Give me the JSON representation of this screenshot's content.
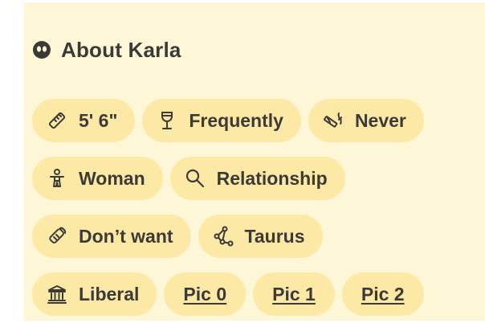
{
  "profile": {
    "heading": "About Karla",
    "heading_icon": "bumble-honeycomb-icon"
  },
  "tags": {
    "row1": [
      {
        "label": "5' 6\"",
        "icon": "ruler-icon"
      },
      {
        "label": "Frequently",
        "icon": "wine-glass-icon"
      },
      {
        "label": "Never",
        "icon": "smoking-icon"
      }
    ],
    "row2": [
      {
        "label": "Woman",
        "icon": "person-icon"
      },
      {
        "label": "Relationship",
        "icon": "magnifier-icon"
      }
    ],
    "row3": [
      {
        "label": "Don’t want",
        "icon": "pacifier-icon"
      },
      {
        "label": "Taurus",
        "icon": "constellation-icon"
      }
    ],
    "row4": [
      {
        "label": "Liberal",
        "icon": "capitol-building-icon"
      }
    ]
  },
  "pics": [
    {
      "label": "Pic 0"
    },
    {
      "label": "Pic 1"
    },
    {
      "label": "Pic 2"
    }
  ],
  "colors": {
    "card_background": "#fef7d7",
    "chip_background": "#fde9a6",
    "text": "#3c3a36"
  }
}
